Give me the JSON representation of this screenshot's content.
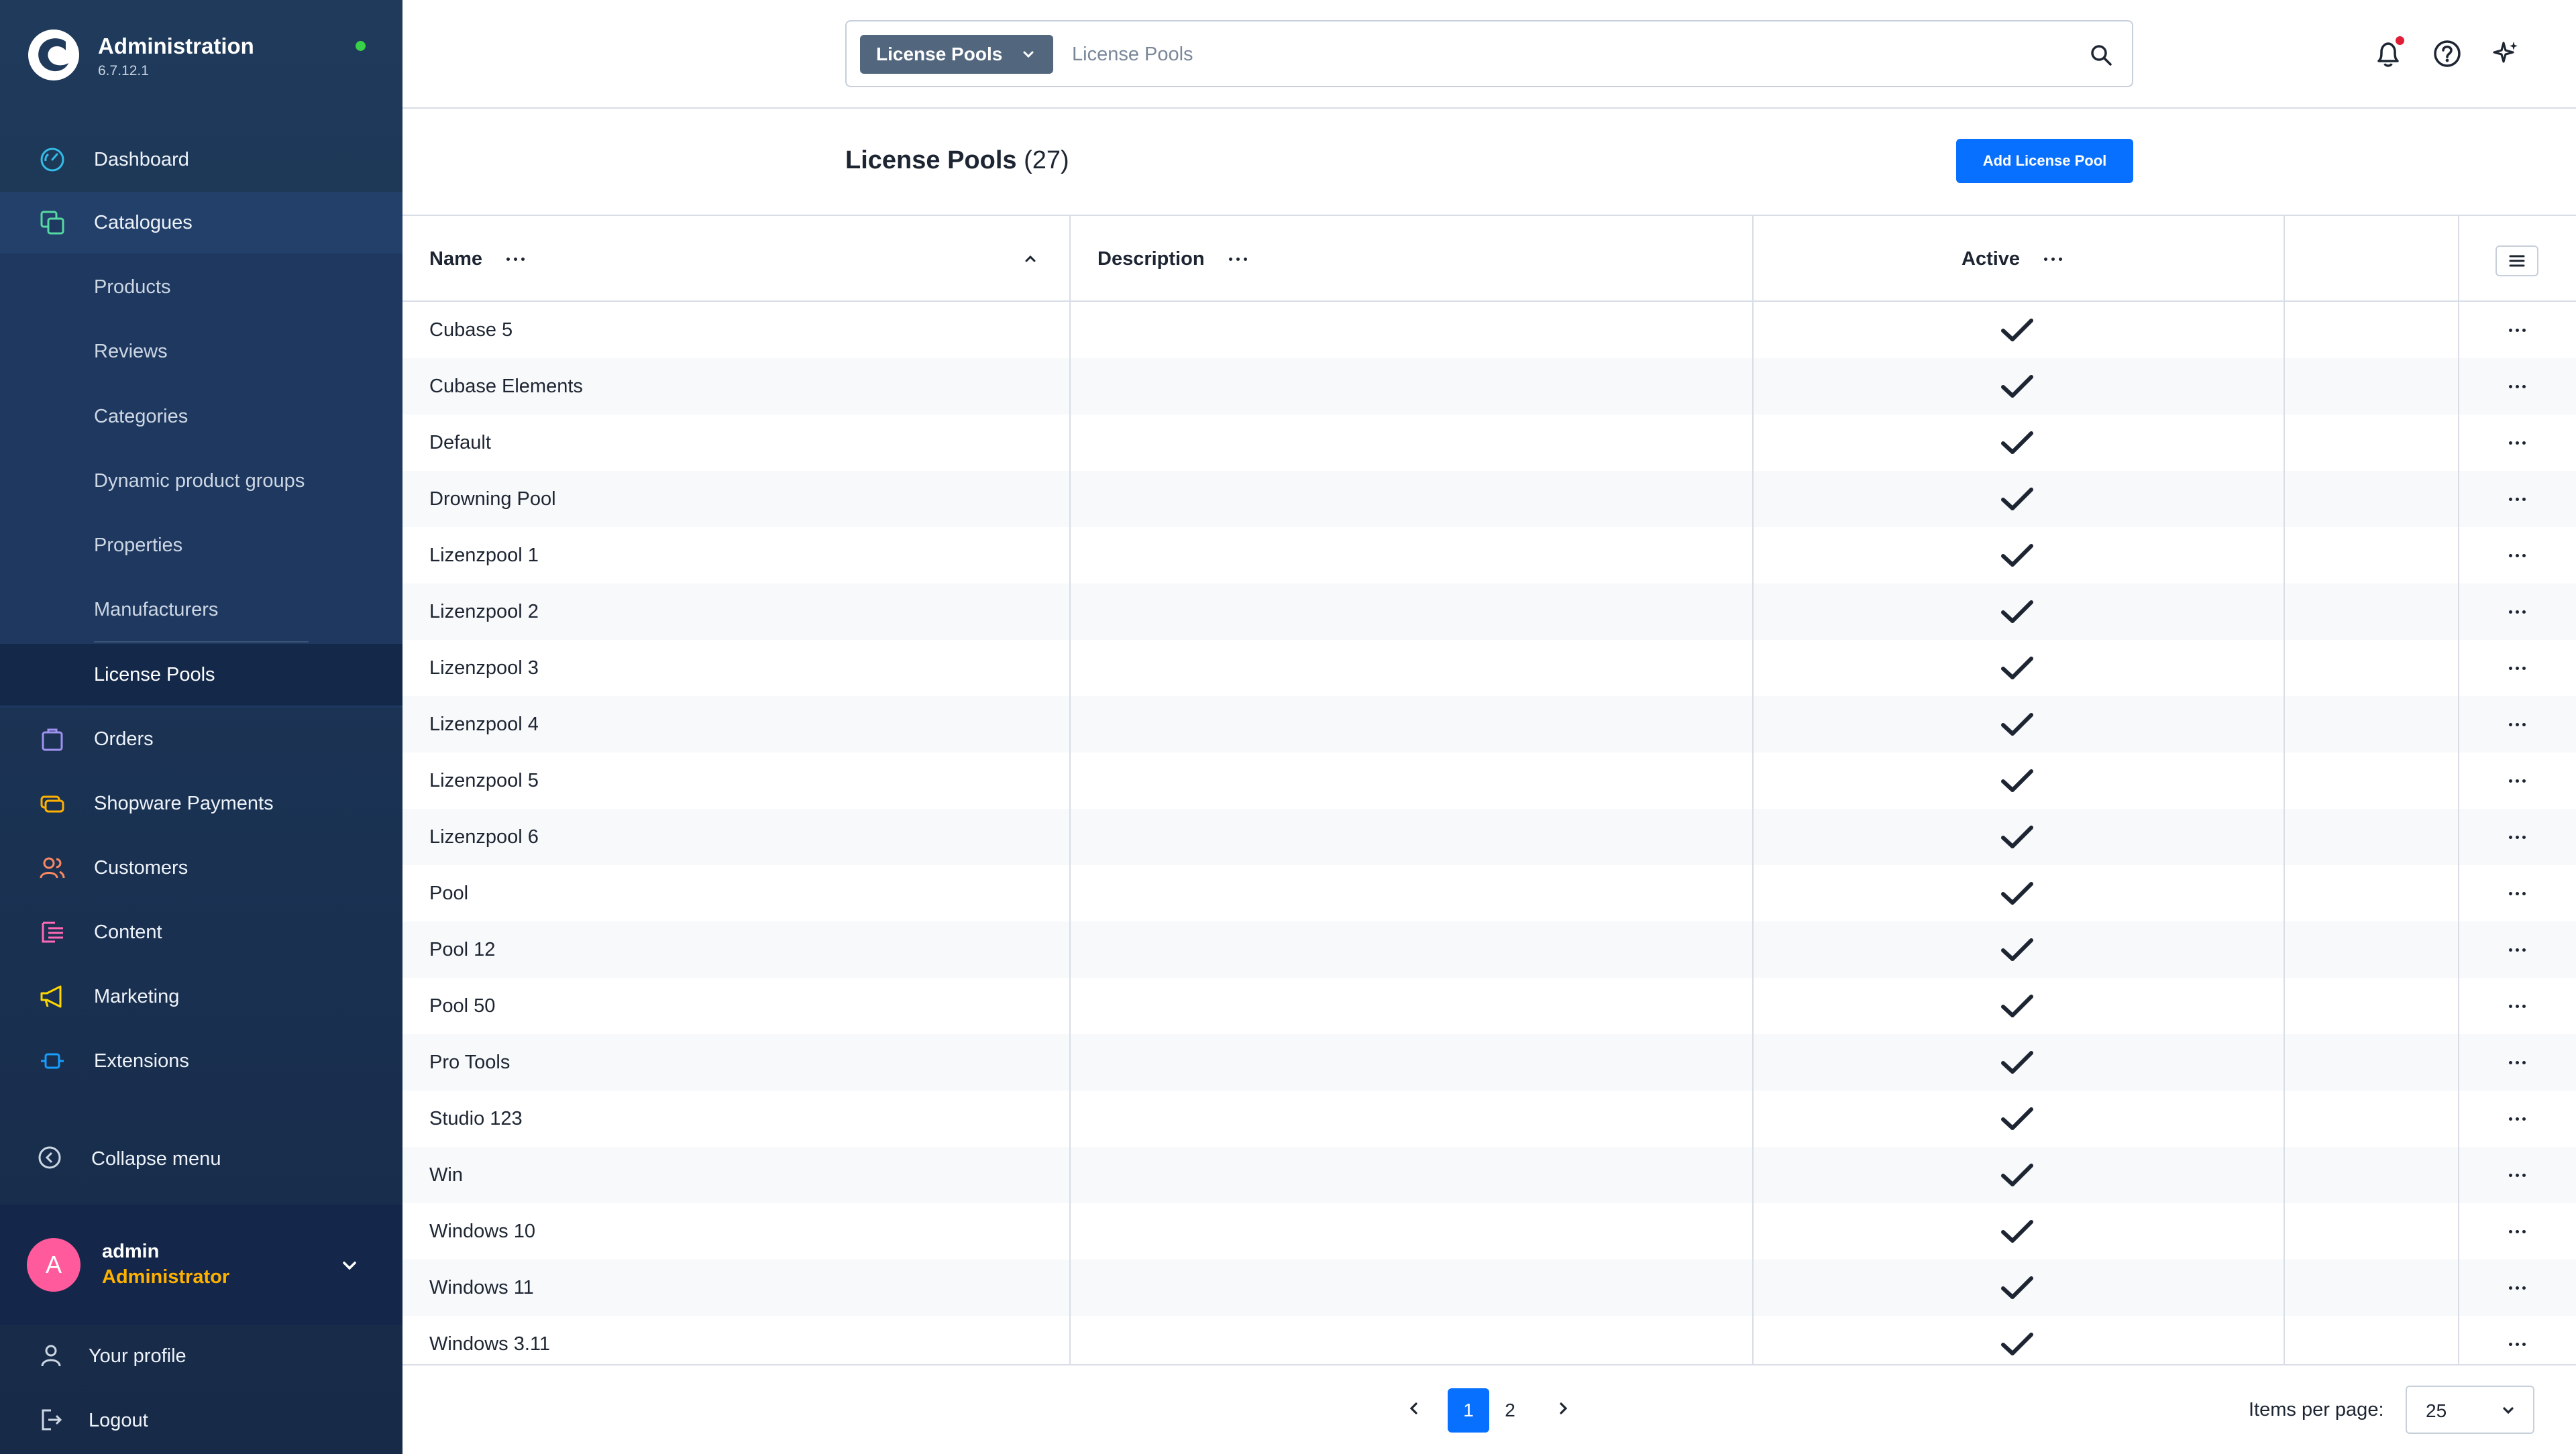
{
  "app": {
    "title": "Administration",
    "version": "6.7.12.1",
    "status": "online"
  },
  "sidebar": {
    "items": [
      {
        "label": "Dashboard",
        "icon": "dashboard-icon",
        "color": "#33bde6"
      },
      {
        "label": "Catalogues",
        "icon": "catalogue-icon",
        "color": "#57d9a3"
      },
      {
        "label": "Products",
        "sub": true
      },
      {
        "label": "Reviews",
        "sub": true
      },
      {
        "label": "Categories",
        "sub": true
      },
      {
        "label": "Dynamic product groups",
        "sub": true
      },
      {
        "label": "Properties",
        "sub": true
      },
      {
        "label": "Manufacturers",
        "sub": true
      },
      {
        "label": "License Pools",
        "sub": true,
        "current": true
      },
      {
        "label": "Orders",
        "icon": "orders-icon",
        "color": "#a092f0"
      },
      {
        "label": "Shopware Payments",
        "icon": "payments-icon",
        "color": "#ffb100"
      },
      {
        "label": "Customers",
        "icon": "customers-icon",
        "color": "#f88962"
      },
      {
        "label": "Content",
        "icon": "content-icon",
        "color": "#ff68b4"
      },
      {
        "label": "Marketing",
        "icon": "marketing-icon",
        "color": "#ffd700"
      },
      {
        "label": "Extensions",
        "icon": "extensions-icon",
        "color": "#189eff"
      }
    ],
    "collapse_label": "Collapse menu",
    "user": {
      "initial": "A",
      "name": "admin",
      "role": "Administrator"
    },
    "profile_label": "Your profile",
    "logout_label": "Logout"
  },
  "search": {
    "type_label": "License Pools",
    "placeholder": "License Pools"
  },
  "page": {
    "title": "License Pools",
    "count": "(27)",
    "add_button": "Add License Pool"
  },
  "grid": {
    "columns": {
      "name": "Name",
      "description": "Description",
      "active": "Active"
    },
    "sort": "ascending",
    "rows": [
      {
        "name": "Cubase 5",
        "description": "",
        "active": true
      },
      {
        "name": "Cubase Elements",
        "description": "",
        "active": true
      },
      {
        "name": "Default",
        "description": "",
        "active": true
      },
      {
        "name": "Drowning Pool",
        "description": "",
        "active": true
      },
      {
        "name": "Lizenzpool 1",
        "description": "",
        "active": true
      },
      {
        "name": "Lizenzpool 2",
        "description": "",
        "active": true
      },
      {
        "name": "Lizenzpool 3",
        "description": "",
        "active": true
      },
      {
        "name": "Lizenzpool 4",
        "description": "",
        "active": true
      },
      {
        "name": "Lizenzpool 5",
        "description": "",
        "active": true
      },
      {
        "name": "Lizenzpool 6",
        "description": "",
        "active": true
      },
      {
        "name": "Pool",
        "description": "",
        "active": true
      },
      {
        "name": "Pool 12",
        "description": "",
        "active": true
      },
      {
        "name": "Pool 50",
        "description": "",
        "active": true
      },
      {
        "name": "Pro Tools",
        "description": "",
        "active": true
      },
      {
        "name": "Studio 123",
        "description": "",
        "active": true
      },
      {
        "name": "Win",
        "description": "",
        "active": true
      },
      {
        "name": "Windows 10",
        "description": "",
        "active": true
      },
      {
        "name": "Windows 11",
        "description": "",
        "active": true
      },
      {
        "name": "Windows 3.11",
        "description": "",
        "active": true
      }
    ]
  },
  "pagination": {
    "pages": [
      "1",
      "2"
    ],
    "current_page": "1",
    "items_per_page_label": "Items per page:",
    "items_per_page": "25"
  },
  "colors": {
    "primary": "#0870ff",
    "sidebar_bg": "#1f3a5a",
    "notification": "#e01e37",
    "online": "#37d046",
    "avatar": "#ff5a9b",
    "role": "#ffb100"
  }
}
